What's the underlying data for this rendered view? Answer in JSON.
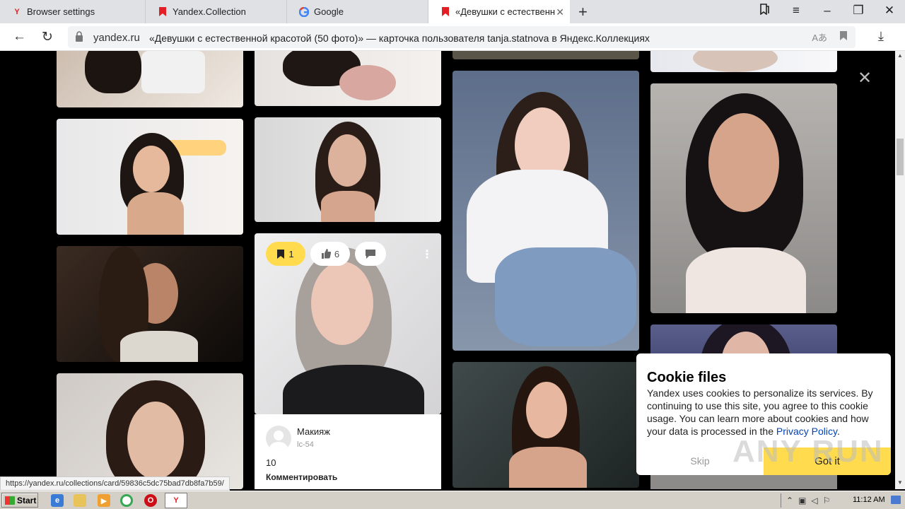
{
  "browser": {
    "tabs": [
      {
        "label": "Browser settings",
        "icon": "yandex-icon"
      },
      {
        "label": "Yandex.Collection",
        "icon": "collections-icon"
      },
      {
        "label": "Google",
        "icon": "google-icon"
      },
      {
        "label": "«Девушки с естественн",
        "icon": "collections-icon",
        "active": true
      }
    ],
    "address": {
      "domain": "yandex.ru",
      "title": "«Девушки с естественной красотой (50 фото)» — карточка пользователя tanja.statnova в Яндекс.Коллекциях"
    }
  },
  "card": {
    "save_count": "1",
    "like_count": "6",
    "board_title": "Макияж",
    "board_owner": "lc-54",
    "count": "10",
    "comment_action": "Комментировать"
  },
  "cookie": {
    "title": "Cookie files",
    "text": "Yandex uses cookies to personalize its services. By continuing to use this site, you agree to this cookie usage. You can learn more about cookies and how your data is processed in the",
    "link": "Privacy Policy",
    "period": ".",
    "skip": "Skip",
    "accept": "Got it"
  },
  "status_url": "https://yandex.ru/collections/card/59836c5dc75bad7db8fa7b59/",
  "watermark": "ANY RUN",
  "taskbar": {
    "start": "Start",
    "clock": "11:12 AM"
  },
  "colors": {
    "accent_yellow": "#ffdb4d",
    "link_blue": "#0044bb",
    "yandex_red": "#e31e24"
  }
}
